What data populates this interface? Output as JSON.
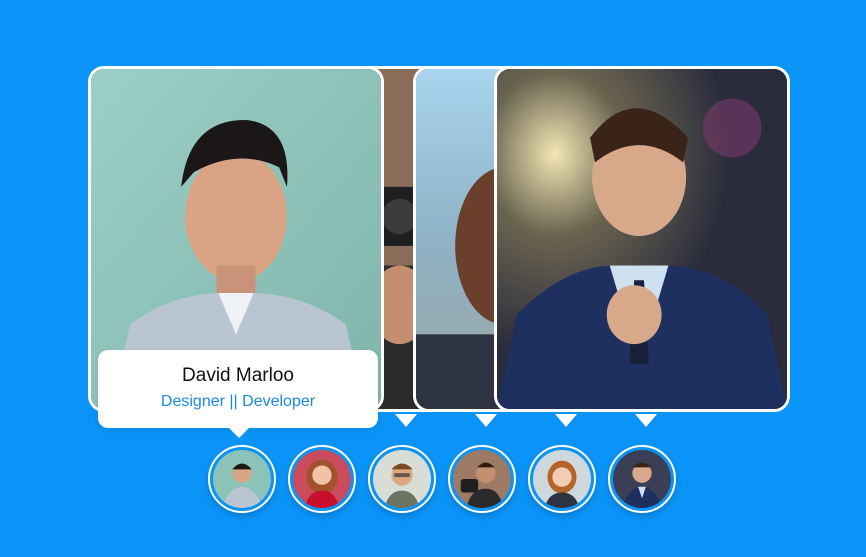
{
  "slider": {
    "active_index": 0,
    "profiles": [
      {
        "id": "profile-1",
        "name": "David Marloo",
        "role": "Designer || Developer",
        "photo_bg": "#8cc3b8",
        "shirt": "#b9c6d2"
      },
      {
        "id": "profile-2",
        "photo_bg": "#c94b5c",
        "shirt": "#c8102e"
      },
      {
        "id": "profile-3",
        "photo_bg": "#d8ddd6",
        "shirt": "#5f6b5a"
      },
      {
        "id": "profile-4",
        "photo_bg": "#9c7a64",
        "shirt": "#2b2b2b"
      },
      {
        "id": "profile-5",
        "photo_bg": "#8fb2c6",
        "shirt": "#2d3340"
      },
      {
        "id": "profile-6",
        "photo_bg": "#3a3f55",
        "shirt": "#1d3060"
      }
    ]
  },
  "info": {
    "name": "David Marloo",
    "role": "Designer || Developer"
  },
  "colors": {
    "background": "#0a94f7",
    "accent": "#1a88e8",
    "card_border": "#ffffff"
  }
}
